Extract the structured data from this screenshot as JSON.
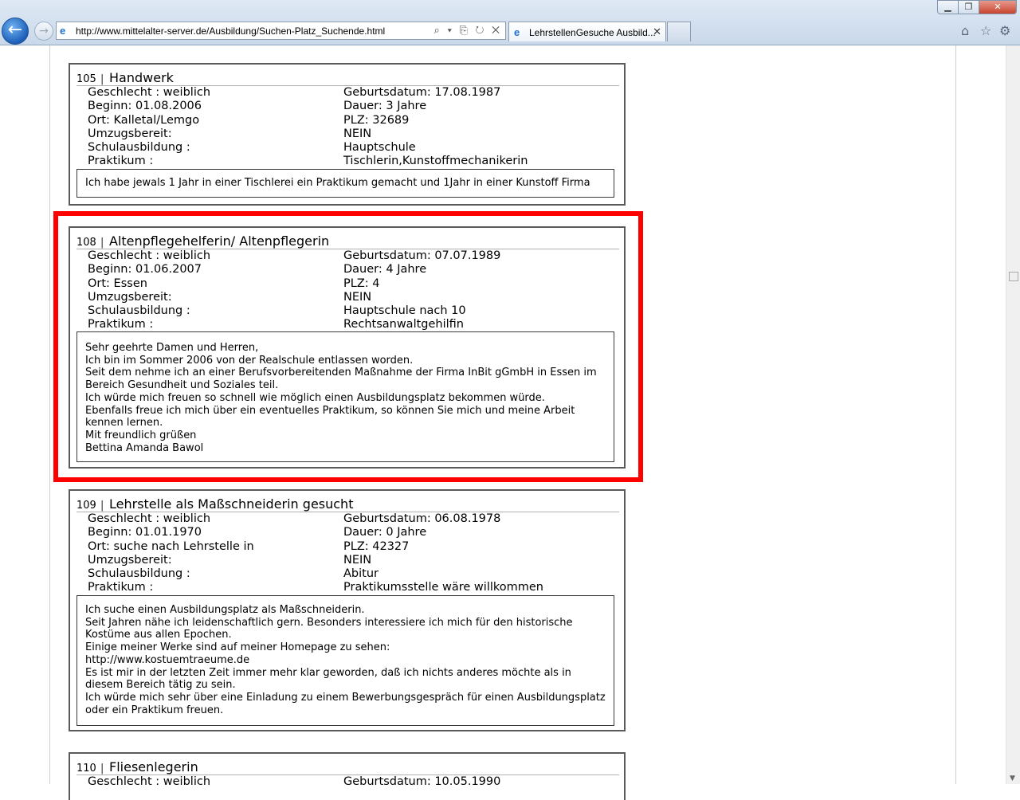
{
  "browser": {
    "url": "http://www.mittelalter-server.de/Ausbildung/Suchen-Platz_Suchende.html",
    "tab_title": "LehrstellenGesuche Ausbild...",
    "tab_close": "✕",
    "address_tools": "⌕ ▾ ⎘ ↻ ✕"
  },
  "entries": [
    {
      "number": "105",
      "sep": "|",
      "title": "Handwerk",
      "fields": [
        {
          "left": "Geschlecht : weiblich",
          "right": "Geburtsdatum: 17.08.1987"
        },
        {
          "left": "Beginn: 01.08.2006",
          "right": "Dauer: 3 Jahre"
        },
        {
          "left": "Ort: Kalletal/Lemgo",
          "right": "PLZ: 32689"
        },
        {
          "left": "Umzugsbereit:",
          "right": "NEIN"
        },
        {
          "left": "Schulausbildung :",
          "right": "Hauptschule"
        },
        {
          "left": "Praktikum :",
          "right": "Tischlerin,Kunstoffmechanikerin"
        }
      ],
      "message": "Ich habe jewals 1 Jahr in einer Tischlerei ein Praktikum gemacht und 1Jahr in einer Kunstoff Firma"
    },
    {
      "number": "108",
      "sep": "|",
      "title": "Altenpflegehelferin/ Altenpflegerin",
      "fields": [
        {
          "left": "Geschlecht : weiblich",
          "right": "Geburtsdatum: 07.07.1989"
        },
        {
          "left": "Beginn: 01.06.2007",
          "right": "Dauer: 4 Jahre"
        },
        {
          "left": "Ort: Essen",
          "right": "PLZ: 4"
        },
        {
          "left": "Umzugsbereit:",
          "right": "NEIN"
        },
        {
          "left": "Schulausbildung :",
          "right": "Hauptschule nach 10"
        },
        {
          "left": "Praktikum :",
          "right": "Rechtsanwaltgehilfin"
        }
      ],
      "message": "Sehr geehrte Damen und Herren,\nIch bin im Sommer 2006 von der Realschule entlassen worden.\nSeit dem nehme ich an einer Berufsvorbereitenden Maßnahme der Firma InBit gGmbH in Essen im Bereich Gesundheit und Soziales teil.\nIch würde mich freuen so schnell wie möglich einen Ausbildungsplatz bekommen würde.\nEbenfalls freue ich mich über ein eventuelles Praktikum, so können Sie mich und meine Arbeit kennen lernen.\nMit freundlich grüßen\nBettina Amanda Bawol"
    },
    {
      "number": "109",
      "sep": "|",
      "title": "Lehrstelle als Maßschneiderin gesucht",
      "fields": [
        {
          "left": "Geschlecht : weiblich",
          "right": "Geburtsdatum: 06.08.1978"
        },
        {
          "left": "Beginn: 01.01.1970",
          "right": "Dauer: 0 Jahre"
        },
        {
          "left": "Ort: suche nach Lehrstelle in",
          "right": "PLZ: 42327"
        },
        {
          "left": "Umzugsbereit:",
          "right": "NEIN"
        },
        {
          "left": "Schulausbildung :",
          "right": "Abitur"
        },
        {
          "left": "Praktikum :",
          "right": "Praktikumsstelle wäre willkommen"
        }
      ],
      "message": "Ich suche einen Ausbildungsplatz als Maßschneiderin.\nSeit Jahren nähe ich leidenschaftlich gern. Besonders interessiere ich mich für den historische Kostüme aus allen Epochen.\nEinige meiner Werke sind auf meiner Homepage zu sehen:\nhttp://www.kostuemtraeume.de\nEs ist mir in der letzten Zeit immer mehr klar geworden, daß ich nichts anderes möchte als in diesem Bereich tätig zu sein.\nIch würde mich sehr über eine Einladung zu einem Bewerbungsgespräch für einen Ausbildungsplatz oder ein Praktikum freuen."
    },
    {
      "number": "110",
      "sep": "|",
      "title": "Fliesenlegerin",
      "fields": [
        {
          "left": "Geschlecht : weiblich",
          "right": "Geburtsdatum: 10.05.1990"
        }
      ]
    }
  ],
  "colors": {
    "highlight": "#ff0000",
    "border": "#5a5a5a"
  }
}
